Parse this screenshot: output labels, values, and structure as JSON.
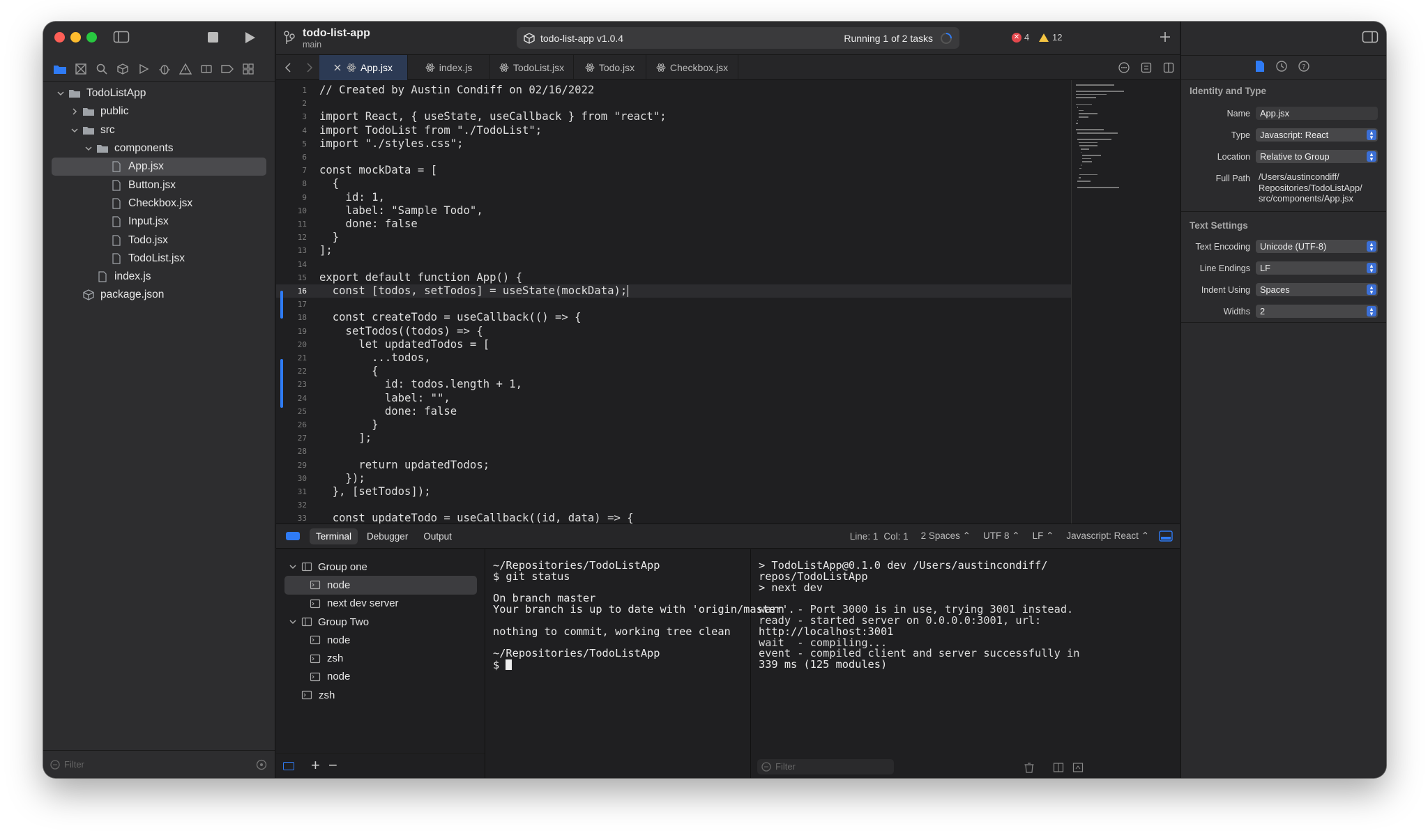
{
  "window": {
    "project": "todo-list-app",
    "branch": "main",
    "scheme": "todo-list-app v1.0.4",
    "running": "Running 1 of 2 tasks",
    "errors": "4",
    "warnings": "12"
  },
  "navigator": {
    "tree": [
      {
        "label": "TodoListApp",
        "depth": 0,
        "kind": "folder",
        "chev": "down"
      },
      {
        "label": "public",
        "depth": 1,
        "kind": "folder",
        "chev": "right"
      },
      {
        "label": "src",
        "depth": 1,
        "kind": "folder",
        "chev": "down"
      },
      {
        "label": "components",
        "depth": 2,
        "kind": "folder",
        "chev": "down"
      },
      {
        "label": "App.jsx",
        "depth": 3,
        "kind": "file",
        "selected": true
      },
      {
        "label": "Button.jsx",
        "depth": 3,
        "kind": "file"
      },
      {
        "label": "Checkbox.jsx",
        "depth": 3,
        "kind": "file"
      },
      {
        "label": "Input.jsx",
        "depth": 3,
        "kind": "file"
      },
      {
        "label": "Todo.jsx",
        "depth": 3,
        "kind": "file"
      },
      {
        "label": "TodoList.jsx",
        "depth": 3,
        "kind": "file"
      },
      {
        "label": "index.js",
        "depth": 2,
        "kind": "file"
      },
      {
        "label": "package.json",
        "depth": 1,
        "kind": "package"
      }
    ],
    "filter_placeholder": "Filter"
  },
  "tabs": [
    {
      "label": "App.jsx",
      "active": true
    },
    {
      "label": "index.js"
    },
    {
      "label": "TodoList.jsx"
    },
    {
      "label": "Todo.jsx"
    },
    {
      "label": "Checkbox.jsx"
    }
  ],
  "code": [
    "// Created by Austin Condiff on 02/16/2022",
    "",
    "import React, { useState, useCallback } from \"react\";",
    "import TodoList from \"./TodoList\";",
    "import \"./styles.css\";",
    "",
    "const mockData = [",
    "  {",
    "    id: 1,",
    "    label: \"Sample Todo\",",
    "    done: false",
    "  }",
    "];",
    "",
    "export default function App() {",
    "  const [todos, setTodos] = useState(mockData);",
    "",
    "  const createTodo = useCallback(() => {",
    "    setTodos((todos) => {",
    "      let updatedTodos = [",
    "        ...todos,",
    "        {",
    "          id: todos.length + 1,",
    "          label: \"\",",
    "          done: false",
    "        }",
    "      ];",
    "",
    "      return updatedTodos;",
    "    });",
    "  }, [setTodos]);",
    "",
    "  const updateTodo = useCallback((id, data) => {"
  ],
  "current_line": 16,
  "bottom_bar": {
    "tabs": [
      "Terminal",
      "Debugger",
      "Output"
    ],
    "line": "Line: 1",
    "col": "Col: 1",
    "indent": "2 Spaces",
    "encoding": "UTF 8",
    "endings": "LF",
    "language": "Javascript: React"
  },
  "terminal_groups": [
    {
      "label": "Group one",
      "type": "group"
    },
    {
      "label": "node",
      "type": "term",
      "selected": true
    },
    {
      "label": "next dev server",
      "type": "term"
    },
    {
      "label": "Group Two",
      "type": "group"
    },
    {
      "label": "node",
      "type": "term"
    },
    {
      "label": "zsh",
      "type": "term"
    },
    {
      "label": "node",
      "type": "term"
    },
    {
      "label": "zsh",
      "type": "solo"
    }
  ],
  "terminal_left": [
    "~/Repositories/TodoListApp",
    "$ git status",
    "",
    "On branch master",
    "Your branch is up to date with 'origin/master'.",
    "",
    "nothing to commit, working tree clean",
    "",
    "~/Repositories/TodoListApp",
    "$ "
  ],
  "terminal_right": [
    "> TodoListApp@0.1.0 dev /Users/austincondiff/",
    "repos/TodoListApp",
    "> next dev",
    "",
    "warn  - Port 3000 is in use, trying 3001 instead.",
    "ready - started server on 0.0.0.0:3001, url:",
    "http://localhost:3001",
    "wait  - compiling...",
    "event - compiled client and server successfully in",
    "339 ms (125 modules)"
  ],
  "terminal_filter_placeholder": "Filter",
  "inspector": {
    "identity_title": "Identity and Type",
    "name_label": "Name",
    "name": "App.jsx",
    "type_label": "Type",
    "type": "Javascript: React",
    "location_label": "Location",
    "location": "Relative to Group",
    "fullpath_label": "Full Path",
    "fullpath": [
      "/Users/austincondiff/",
      "Repositories/TodoListApp/",
      "src/components/App.jsx"
    ],
    "text_title": "Text Settings",
    "encoding_label": "Text Encoding",
    "encoding": "Unicode (UTF-8)",
    "endings_label": "Line Endings",
    "endings": "LF",
    "indent_label": "Indent Using",
    "indent": "Spaces",
    "widths_label": "Widths",
    "widths": "2"
  },
  "colors": {
    "accent": "#2f7bf5",
    "active_tab": "#2c3a54",
    "error": "#e5484d",
    "warning": "#f5c542"
  }
}
